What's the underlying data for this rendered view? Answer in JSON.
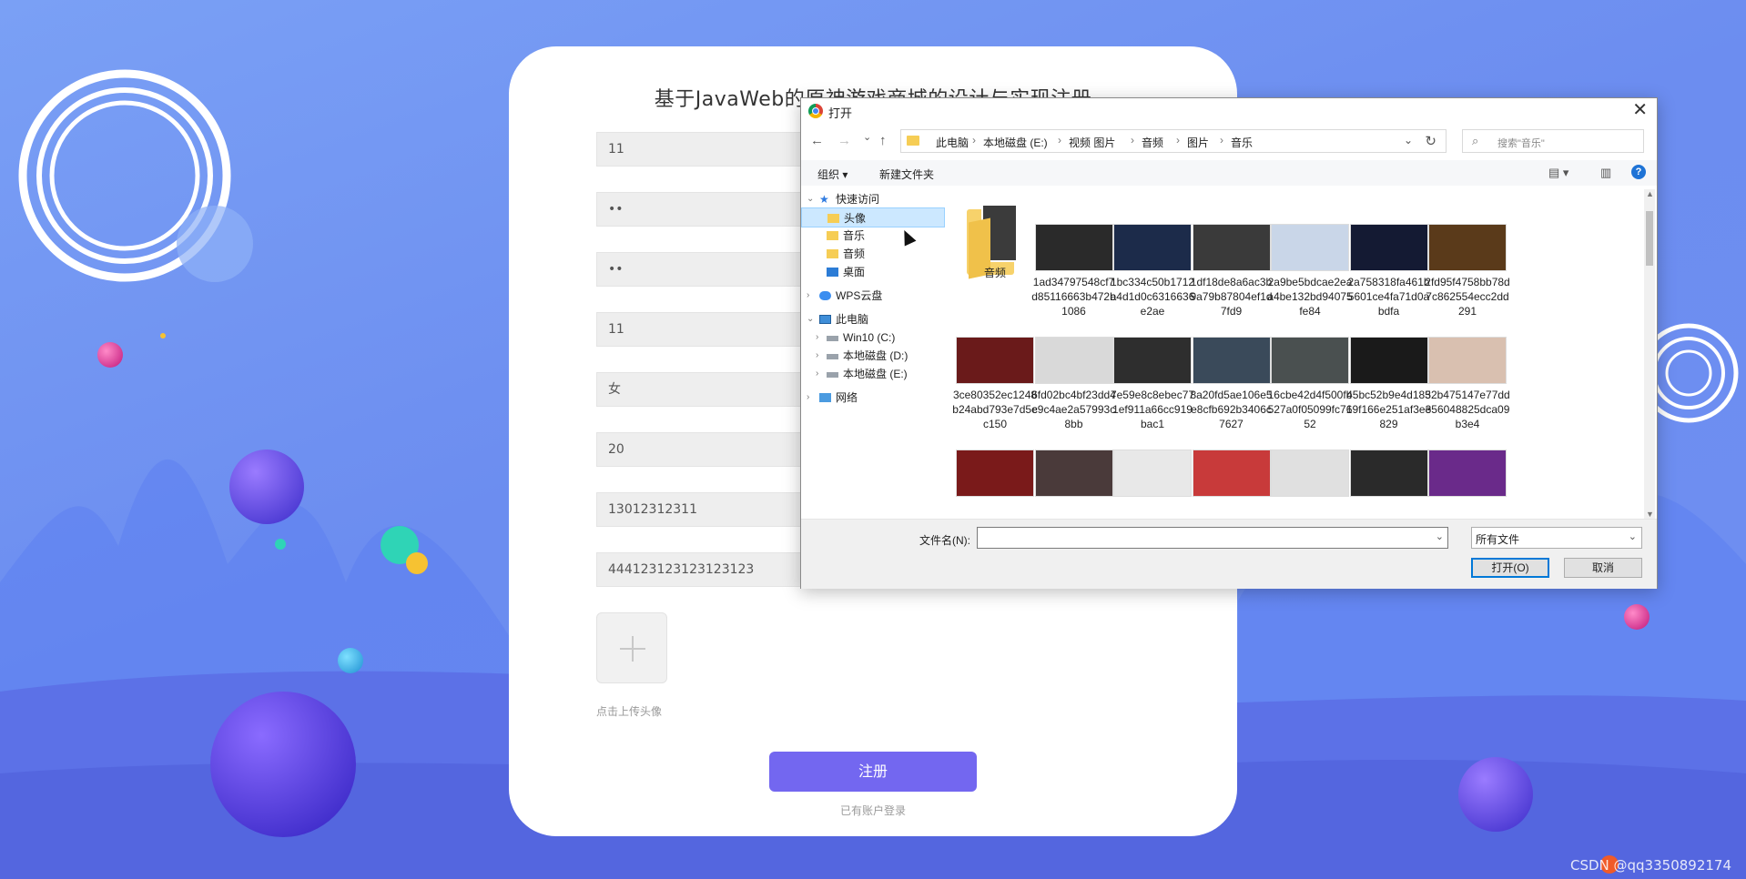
{
  "register": {
    "title": "基于JavaWeb的原神游戏商城的设计与实现注册",
    "fields": [
      "11",
      "••",
      "••",
      "11",
      "女",
      "20",
      "13012312311",
      "444123123123123123"
    ],
    "upload_hint": "点击上传头像",
    "submit_label": "注册",
    "login_link": "已有账户登录"
  },
  "dialog": {
    "title": "打开",
    "close": "✕",
    "nav": {
      "back": "←",
      "forward": "→",
      "recent": "⌄",
      "up": "↑"
    },
    "breadcrumb": [
      "此电脑",
      "本地磁盘 (E:)",
      "视频 图片",
      "音频",
      "图片",
      "音乐"
    ],
    "breadcrumb_sep": "›",
    "refresh": "↻",
    "search_placeholder": "搜索\"音乐\"",
    "toolbar": {
      "organize": "组织 ▾",
      "new_folder": "新建文件夹",
      "help": "?"
    },
    "tree": [
      {
        "label": "快速访问",
        "icon": "star-icon",
        "chev": "⌄",
        "indent": 0
      },
      {
        "label": "头像",
        "icon": "folder-icon",
        "selected": true,
        "indent": 1
      },
      {
        "label": "音乐",
        "icon": "folder-icon",
        "indent": 1
      },
      {
        "label": "音频",
        "icon": "folder-icon",
        "indent": 1
      },
      {
        "label": "桌面",
        "icon": "desktop-icon",
        "indent": 1
      },
      {
        "label": "WPS云盘",
        "icon": "cloud-icon",
        "chev": "›",
        "indent": 0
      },
      {
        "label": "此电脑",
        "icon": "computer-icon",
        "chev": "⌄",
        "indent": 0
      },
      {
        "label": "Win10 (C:)",
        "icon": "drive-icon",
        "chev": "›",
        "indent": 1
      },
      {
        "label": "本地磁盘 (D:)",
        "icon": "drive-icon",
        "chev": "›",
        "indent": 1
      },
      {
        "label": "本地磁盘 (E:)",
        "icon": "drive-icon",
        "chev": "›",
        "indent": 1
      },
      {
        "label": "网络",
        "icon": "network-icon",
        "chev": "›",
        "indent": 0
      }
    ],
    "files": [
      {
        "name": "音频",
        "type": "folder",
        "color": "#f7d26b"
      },
      {
        "name": "1ad34797548cf7d85116663b472b1086",
        "color": "#2a2a2a"
      },
      {
        "name": "1bc334c50b1712a4d1d0c6316636e2ae",
        "color": "#1c2b4a"
      },
      {
        "name": "1df18de8a6ac3b9a79b87804ef1d7fd9",
        "color": "#3a3a3a"
      },
      {
        "name": "2a9be5bdcae2eaa4be132bd94075fe84",
        "color": "#c9d6e8"
      },
      {
        "name": "2a758318fa461b5601ce4fa71d0abdfa",
        "color": "#141a33"
      },
      {
        "name": "2fd95f4758bb78d7c862554ecc2dd291",
        "color": "#5a3a1a"
      },
      {
        "name": "3ce80352ec1248b24abd793e7d5ec150",
        "color": "#6a1a1a"
      },
      {
        "name": "6fd02bc4bf23dd4c9c4ae2a57993c8bb",
        "color": "#d9d9d9"
      },
      {
        "name": "7e59e8c8ebec771ef911a66cc919bac1",
        "color": "#2e2e2e"
      },
      {
        "name": "8a20fd5ae106e5e8cfb692b3406c7627",
        "color": "#3a4a5a"
      },
      {
        "name": "16cbe42d4f500fb527a0f05099fc7652",
        "color": "#4a5050"
      },
      {
        "name": "45bc52b9e4d18319f166e251af3ee829",
        "color": "#1a1a1a"
      },
      {
        "name": "52b475147e77dd356048825dca09b3e4",
        "color": "#d9c0b0"
      },
      {
        "name": "",
        "color": "#7a1a1a"
      },
      {
        "name": "",
        "color": "#4a3a3a"
      },
      {
        "name": "",
        "color": "#e8e8e8"
      },
      {
        "name": "",
        "color": "#c83a3a"
      },
      {
        "name": "",
        "color": "#e0e0e0"
      },
      {
        "name": "",
        "color": "#2a2a2a"
      },
      {
        "name": "",
        "color": "#6a2a8a"
      }
    ],
    "filename_label": "文件名(N):",
    "filename_value": "",
    "filter_value": "所有文件",
    "open_label": "打开(O)",
    "cancel_label": "取消"
  },
  "watermark": "CSDN @qq3350892174"
}
